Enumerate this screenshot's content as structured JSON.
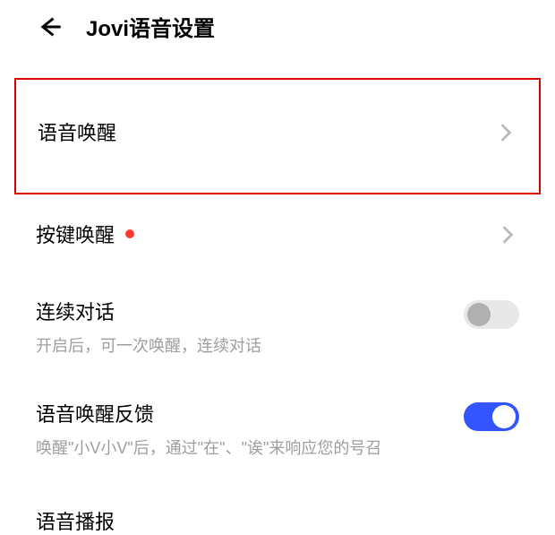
{
  "header": {
    "title": "Jovi语音设置"
  },
  "rows": {
    "voice_wake": {
      "label": "语音唤醒"
    },
    "key_wake": {
      "label": "按键唤醒",
      "has_badge": true
    }
  },
  "toggles": {
    "continuous": {
      "title": "连续对话",
      "desc": "开启后，可一次唤醒，连续对话",
      "on": false
    },
    "wake_feedback": {
      "title": "语音唤醒反馈",
      "desc": "唤醒\"小V小V\"后，通过\"在\"、\"诶\"来响应您的号召",
      "on": true
    }
  },
  "partial": {
    "title": "语音播报"
  }
}
